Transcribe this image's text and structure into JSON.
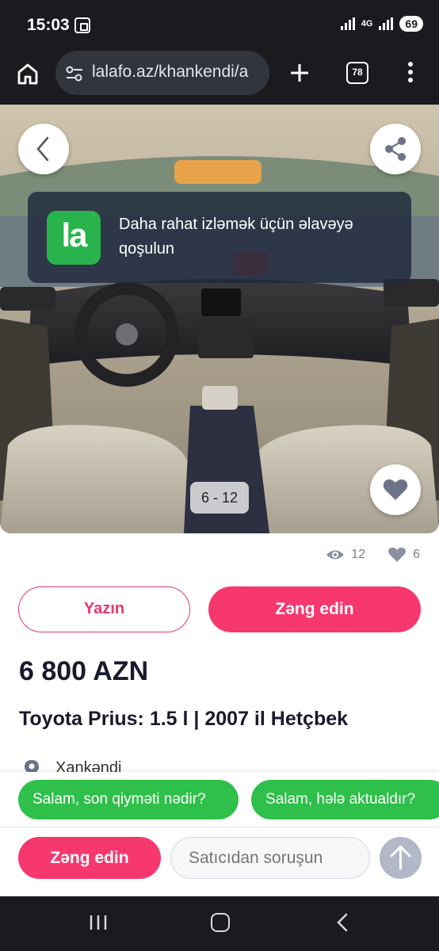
{
  "status_bar": {
    "time": "15:03",
    "network": "4G",
    "battery": "69"
  },
  "browser": {
    "url": "lalafo.az/khankendi/a",
    "tab_count": "78"
  },
  "photo": {
    "counter": "6 - 12"
  },
  "install_banner": {
    "logo": "la",
    "text": "Daha rahat izləmək üçün əlavəyə qoşulun"
  },
  "stats": {
    "views": "12",
    "likes": "6"
  },
  "actions": {
    "write_label": "Yazın",
    "call_label": "Zəng edin"
  },
  "listing": {
    "price": "6 800 AZN",
    "title": "Toyota Prius: 1.5 l | 2007 il Hetçbek",
    "location": "Xankəndi"
  },
  "quick_replies": [
    "Salam, son qiyməti nədir?",
    "Salam, hələ aktualdır?"
  ],
  "bottom_bar": {
    "call_label": "Zəng edin",
    "ask_placeholder": "Satıcıdan soruşun"
  },
  "colors": {
    "accent": "#f6386f",
    "green": "#2ec04a",
    "text": "#1a1a2e"
  },
  "icons": [
    "home-icon",
    "tune-icon",
    "plus-icon",
    "tabs-icon",
    "more-icon",
    "back-arrow-icon",
    "share-icon",
    "heart-icon",
    "eye-icon",
    "pin-icon",
    "send-arrow-icon"
  ]
}
